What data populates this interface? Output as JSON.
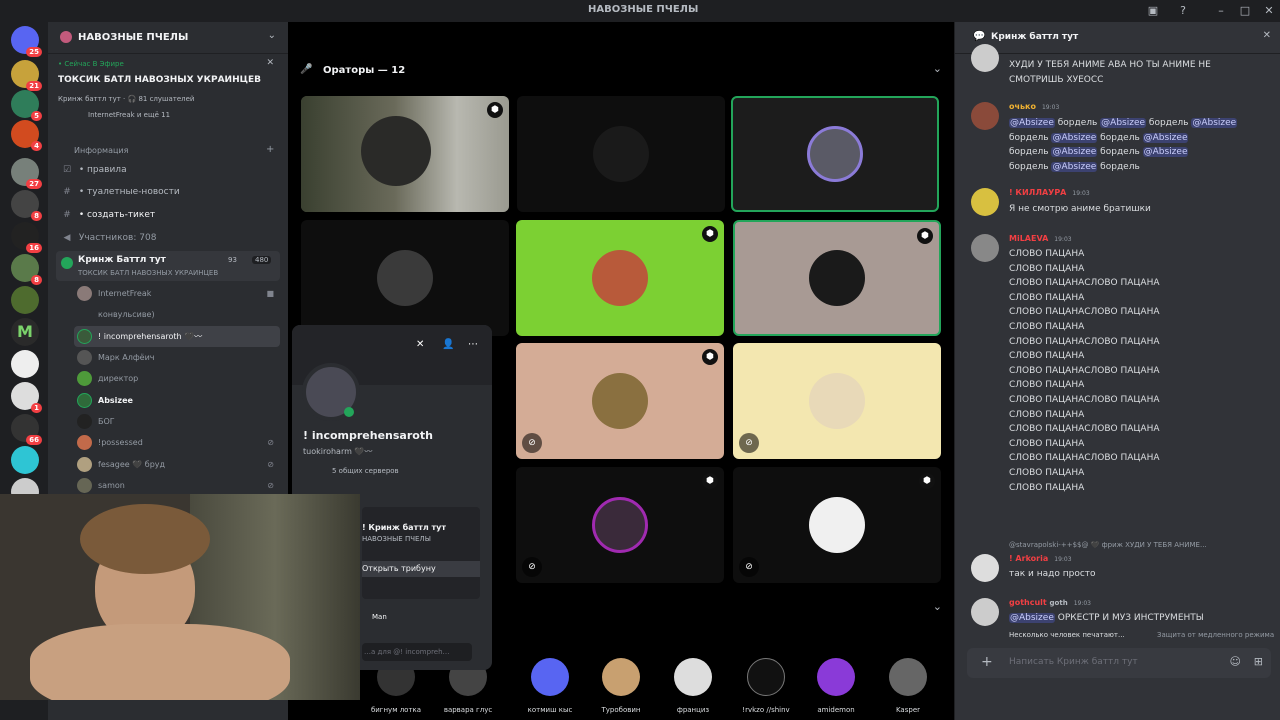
{
  "window": {
    "title": "НАВОЗНЫЕ ПЧЕЛЫ"
  },
  "server": {
    "name": "НАВОЗНЫЕ ПЧЕЛЫ",
    "live_label": "• Сейчас В Эфире",
    "event_title": "ТОКСИК БАТЛ НАВОЗНЫХ УКРАИНЦЕВ",
    "event_meta": "Кринж баттл тут · 🎧 81 слушателей",
    "event_people": "InternetFreak и ещё 11"
  },
  "guild_badges": [
    "25",
    "21",
    "5",
    "4",
    "27",
    "8",
    "16",
    "8",
    "3",
    "1",
    "66"
  ],
  "channels": {
    "category": "Информация",
    "items": [
      {
        "label": "• правила",
        "icon": "☑"
      },
      {
        "label": "• туалетные-новости",
        "icon": "#"
      },
      {
        "label": "• создать-тикет",
        "icon": "#"
      },
      {
        "label": "Участников: 708",
        "icon": "🔈"
      }
    ],
    "voice": {
      "name": "Кринж Баттл тут",
      "sub": "ТОКСИК БАТЛ НАВОЗНЫХ УКРАИНЦЕВ",
      "count1": "93",
      "count2": "480"
    },
    "members": [
      {
        "name": "InternetFreak",
        "color": "#949ba4"
      },
      {
        "name": "конвульсиве)",
        "color": "#949ba4"
      },
      {
        "name": "! incomprehensaroth 🖤〰",
        "color": "#f2f3f5"
      },
      {
        "name": "Марк Алфёич",
        "color": "#949ba4"
      },
      {
        "name": "директор",
        "color": "#949ba4"
      },
      {
        "name": "Absizee",
        "color": "#f2f3f5"
      },
      {
        "name": "БОГ",
        "color": "#949ba4"
      },
      {
        "name": "!possessed",
        "color": "#949ba4"
      },
      {
        "name": "fesagee 🖤 бруд",
        "color": "#949ba4"
      },
      {
        "name": "samon",
        "color": "#949ba4"
      }
    ]
  },
  "stage": {
    "speakers_label": "Ораторы — 12",
    "audience": [
      "бигнум лотка",
      "варвара глус",
      "котмиш кыс",
      "Туробовин",
      "франциз",
      "!rvkzo //shinv",
      "amidemon",
      "Kasper"
    ]
  },
  "popout": {
    "name": "! incomprehensaroth",
    "tag": "tuokiroharm 🖤〰",
    "mutual": "5 общих серверов",
    "card_title": "! Кринж баттл тут",
    "card_sub": "НАВОЗНЫЕ ПЧЕЛЫ",
    "open_stage": "Открыть трибуну",
    "role": "Man",
    "msg_placeholder": "…а для @! incompreh…"
  },
  "chat": {
    "thread_title": "Кринж баттл тут",
    "top_text": "ХУДИ У ТЕБЯ АНИМЕ АВА НО ТЫ АНИМЕ НЕ\nСМОТРИШЬ ХУЕОСС",
    "m1": {
      "user": "очько",
      "time": "19:03",
      "color": "#f0b232"
    },
    "m2": {
      "user": "! КИЛЛАУРА",
      "time": "19:03",
      "color": "#f23f43",
      "text": "Я не смотрю аниме братишки"
    },
    "m3": {
      "user": "MiLAEVA",
      "time": "19:03",
      "color": "#f23f43",
      "text": "СЛОВО ПАЦАНА\nСЛОВО ПАЦАНА\nСЛОВО ПАЦАНАСЛОВО ПАЦАНА\nСЛОВО ПАЦАНА\nСЛОВО ПАЦАНАСЛОВО ПАЦАНА\nСЛОВО ПАЦАНА\nСЛОВО ПАЦАНАСЛОВО ПАЦАНА\nСЛОВО ПАЦАНА\nСЛОВО ПАЦАНАСЛОВО ПАЦАНА\nСЛОВО ПАЦАНА\nСЛОВО ПАЦАНАСЛОВО ПАЦАНА\nСЛОВО ПАЦАНА\nСЛОВО ПАЦАНАСЛОВО ПАЦАНА\nСЛОВО ПАЦАНА\nСЛОВО ПАЦАНАСЛОВО ПАЦАНА\nСЛОВО ПАЦАНА\nСЛОВО ПАЦАНА"
    },
    "reply_preview": "@stavrapolski-++$$@ 🖤 фриж ХУДИ У ТЕБЯ АНИМЕ...",
    "m4": {
      "user": "! Arkoria",
      "time": "19:03",
      "color": "#f23f43",
      "text": "так и надо просто"
    },
    "m5": {
      "user": "gothcult",
      "tag": "goth",
      "time": "19:03",
      "color": "#f23f43",
      "text": "ОРКЕСТР И МУЗ ИНСТРУМЕНТЫ"
    },
    "typing": "Несколько человек печатают...",
    "slowmode": "Защита от медленного режима",
    "placeholder": "Написать Кринж баттл тут"
  }
}
